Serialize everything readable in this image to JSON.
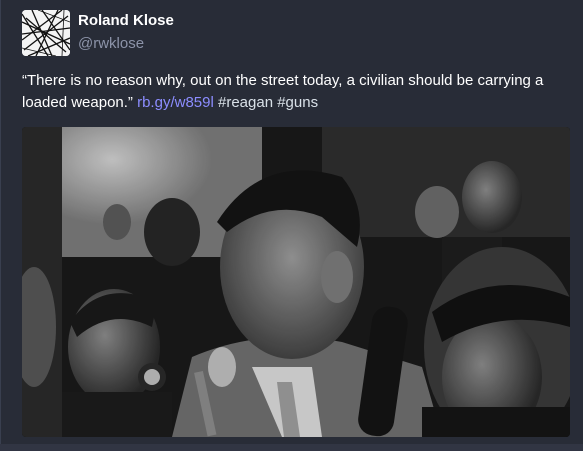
{
  "status": {
    "display_name": "Roland Klose",
    "acct": "@rwklose",
    "text_quote": "“There is no reason why, out on the street today, a civilian should be carrying a loaded weapon.”",
    "link_text": "rb.gy/w859l",
    "hashtag_1": "#reagan",
    "hashtag_2": "#guns",
    "avatar_icon": "abstract-lines-avatar-icon",
    "media": {
      "type": "video-still",
      "description_icon": "black-and-white-press-photo"
    }
  },
  "colors": {
    "background": "#282c37",
    "link": "#8c8dff",
    "muted": "#8c93a8",
    "text": "#ffffff"
  }
}
